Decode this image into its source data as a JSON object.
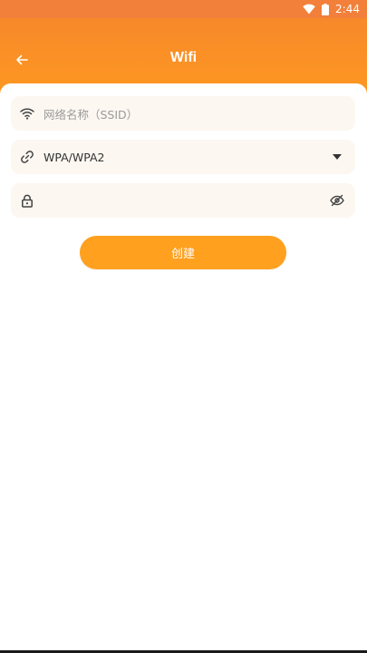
{
  "status_bar": {
    "time": "2:44",
    "icons": [
      "wifi-icon",
      "battery-icon"
    ]
  },
  "app_bar": {
    "title": "Wifi",
    "back_icon": "arrow-left-icon"
  },
  "form": {
    "ssid": {
      "icon": "wifi-icon",
      "placeholder": "网络名称（SSID）",
      "value": ""
    },
    "security": {
      "icon": "link-icon",
      "value": "WPA/WPA2",
      "dropdown_icon": "caret-down-icon"
    },
    "password": {
      "icon": "lock-icon",
      "value": "",
      "toggle_icon": "eye-off-icon"
    },
    "create_label": "创建"
  },
  "colors": {
    "status_bar": "#F2803A",
    "app_bar": "#FF9A20",
    "button": "#FFA01E",
    "field_bg": "#FCF7F1"
  }
}
